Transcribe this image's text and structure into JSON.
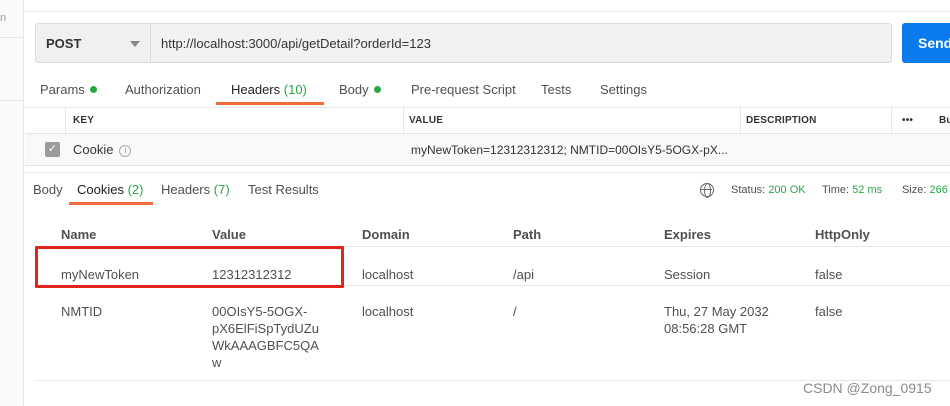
{
  "sidebar": {
    "fragment": "n"
  },
  "request": {
    "method": "POST",
    "url": "http://localhost:3000/api/getDetail?orderId=123",
    "send_label": "Send"
  },
  "request_tabs": {
    "params": "Params",
    "authorization": "Authorization",
    "headers_label": "Headers",
    "headers_count": "(10)",
    "body": "Body",
    "pre_request": "Pre-request Script",
    "tests": "Tests",
    "settings": "Settings"
  },
  "headers_table": {
    "columns": {
      "key": "KEY",
      "value": "VALUE",
      "description": "DESCRIPTION"
    },
    "more": "•••",
    "bulk_edit": "Bu",
    "row": {
      "key": "Cookie",
      "info": "i",
      "value": "myNewToken=12312312312; NMTID=00OIsY5-5OGX-pX..."
    }
  },
  "response_tabs": {
    "body": "Body",
    "cookies_label": "Cookies",
    "cookies_count": "(2)",
    "headers_label": "Headers",
    "headers_count": "(7)",
    "test_results": "Test Results"
  },
  "status_bar": {
    "status_label": "Status:",
    "status_value": "200 OK",
    "time_label": "Time:",
    "time_value": "52 ms",
    "size_label": "Size:",
    "size_value": "266"
  },
  "cookies": {
    "columns": [
      "Name",
      "Value",
      "Domain",
      "Path",
      "Expires",
      "HttpOnly"
    ],
    "rows": [
      {
        "name": "myNewToken",
        "value": "12312312312",
        "domain": "localhost",
        "path": "/api",
        "expires": "Session",
        "httponly": "false"
      },
      {
        "name": "NMTID",
        "value_lines": [
          "00OIsY5-5OGX-",
          "pX6ElFiSpTydUZu",
          "WkAAAGBFC5QA",
          "w"
        ],
        "domain": "localhost",
        "path": "/",
        "expires_lines": [
          "Thu, 27 May 2032",
          "08:56:28 GMT"
        ],
        "httponly": "false"
      }
    ]
  },
  "watermark": "CSDN @Zong_0915",
  "colors": {
    "accent": "#f26b3a",
    "send": "#097bed",
    "success": "#28a745",
    "highlight": "#e0251c"
  }
}
